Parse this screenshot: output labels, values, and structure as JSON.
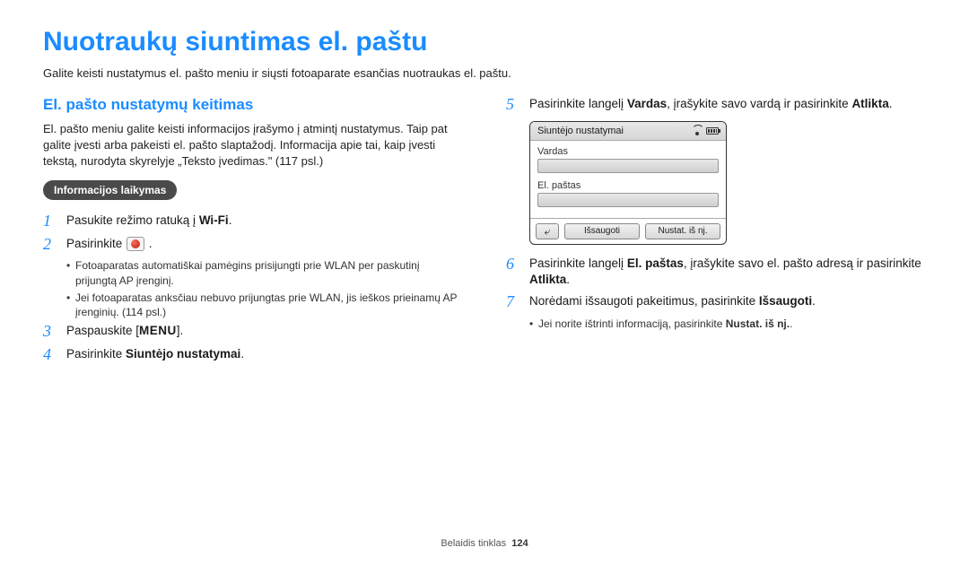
{
  "title": "Nuotraukų siuntimas el. paštu",
  "intro": "Galite keisti nustatymus el. pašto meniu ir siųsti fotoaparate esančias nuotraukas el. paštu.",
  "left": {
    "heading": "El. pašto nustatymų keitimas",
    "desc": "El. pašto meniu galite keisti informacijos įrašymo į atmintį nustatymus. Taip pat galite įvesti arba pakeisti el. pašto slaptažodį. Informacija apie tai, kaip įvesti tekstą, nurodyta skyrelyje „Teksto įvedimas.\" (117 psl.)",
    "pill": "Informacijos laikymas",
    "step1_a": "Pasukite režimo ratuką į ",
    "step1_wifi": "Wi-Fi",
    "step2": "Pasirinkite ",
    "bullets": [
      "Fotoaparatas automatiškai pamėgins prisijungti prie WLAN per paskutinį prijungtą AP įrenginį.",
      "Jei fotoaparatas anksčiau nebuvo prijungtas prie WLAN, jis ieškos prieinamų AP įrenginių. (114 psl.)"
    ],
    "step3_a": "Paspauskite [",
    "step3_menu": "MENU",
    "step3_b": "].",
    "step4_a": "Pasirinkite ",
    "step4_b": "Siuntėjo nustatymai"
  },
  "right": {
    "step5_a": "Pasirinkite langelį ",
    "step5_b": "Vardas",
    "step5_c": ", įrašykite savo vardą ir pasirinkite ",
    "step5_d": "Atlikta",
    "device": {
      "title": "Siuntėjo nustatymai",
      "field1": "Vardas",
      "field2": "El. paštas",
      "btn_save": "Išsaugoti",
      "btn_reset": "Nustat. iš nj."
    },
    "step6_a": "Pasirinkite langelį ",
    "step6_b": "El. paštas",
    "step6_c": ", įrašykite savo el. pašto adresą ir pasirinkite ",
    "step6_d": "Atlikta",
    "step7_a": "Norėdami išsaugoti pakeitimus, pasirinkite ",
    "step7_b": "Išsaugoti",
    "bullet7_a": "Jei norite ištrinti informaciją, pasirinkite ",
    "bullet7_b": "Nustat. iš nj."
  },
  "footer": {
    "section": "Belaidis tinklas",
    "page": "124"
  }
}
